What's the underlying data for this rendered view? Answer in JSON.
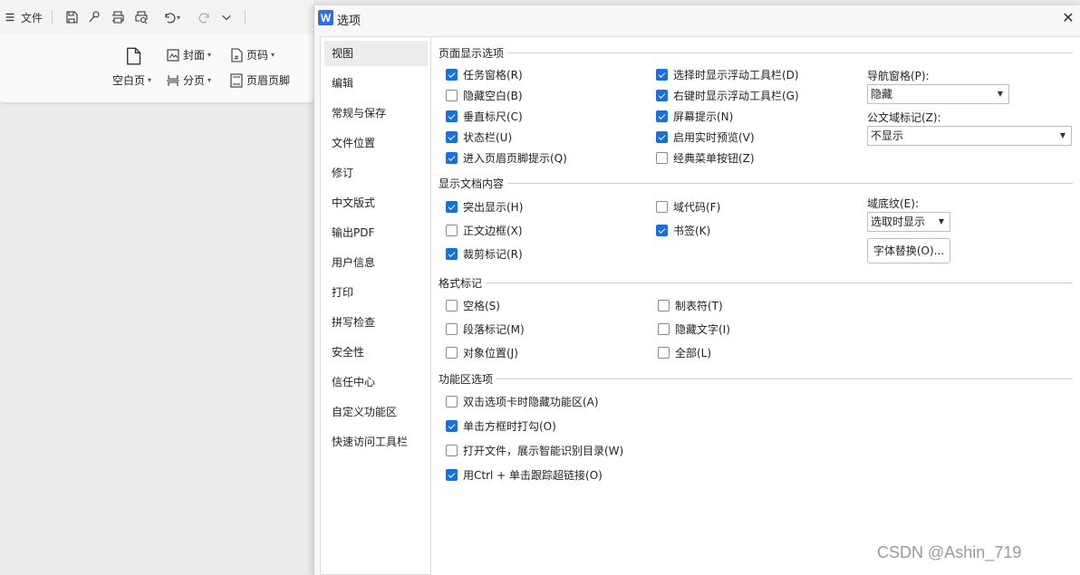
{
  "app": {
    "menu_label": "文件",
    "ribbon": {
      "cover": "封面",
      "page_number": "页码",
      "blank_page": "空白页",
      "page_break": "分页",
      "header_footer": "页眉页脚"
    }
  },
  "dialog": {
    "title": "选项",
    "logo": "W",
    "nav": [
      "视图",
      "编辑",
      "常规与保存",
      "文件位置",
      "修订",
      "中文版式",
      "输出PDF",
      "用户信息",
      "打印",
      "拼写检查",
      "安全性",
      "信任中心",
      "自定义功能区",
      "快速访问工具栏"
    ],
    "selected_nav": "视图",
    "page_display": {
      "heading": "页面显示选项",
      "col1": [
        {
          "label": "任务窗格(R)",
          "checked": true
        },
        {
          "label": "隐藏空白(B)",
          "checked": false
        },
        {
          "label": "垂直标尺(C)",
          "checked": true
        },
        {
          "label": "状态栏(U)",
          "checked": true
        },
        {
          "label": "进入页眉页脚提示(Q)",
          "checked": true
        }
      ],
      "col2": [
        {
          "label": "选择时显示浮动工具栏(D)",
          "checked": true
        },
        {
          "label": "右键时显示浮动工具栏(G)",
          "checked": true
        },
        {
          "label": "屏幕提示(N)",
          "checked": true
        },
        {
          "label": "启用实时预览(V)",
          "checked": true
        },
        {
          "label": "经典菜单按钮(Z)",
          "checked": false
        }
      ],
      "nav_pane_label": "导航窗格(P):",
      "nav_pane_value": "隐藏",
      "doc_field_label": "公文域标记(Z):",
      "doc_field_value": "不显示"
    },
    "doc_content": {
      "heading": "显示文档内容",
      "col1": [
        {
          "label": "突出显示(H)",
          "checked": true
        },
        {
          "label": "正文边框(X)",
          "checked": false
        },
        {
          "label": "裁剪标记(R)",
          "checked": true
        }
      ],
      "col2": [
        {
          "label": "域代码(F)",
          "checked": false
        },
        {
          "label": "书签(K)",
          "checked": true
        }
      ],
      "field_shading_label": "域底纹(E):",
      "field_shading_value": "选取时显示",
      "font_substitution_button": "字体替换(O)..."
    },
    "format_marks": {
      "heading": "格式标记",
      "col1": [
        {
          "label": "空格(S)",
          "checked": false
        },
        {
          "label": "段落标记(M)",
          "checked": false
        },
        {
          "label": "对象位置(J)",
          "checked": false
        }
      ],
      "col2": [
        {
          "label": "制表符(T)",
          "checked": false
        },
        {
          "label": "隐藏文字(I)",
          "checked": false
        },
        {
          "label": "全部(L)",
          "checked": false
        }
      ]
    },
    "ribbon_options": {
      "heading": "功能区选项",
      "items": [
        {
          "label": "双击选项卡时隐藏功能区(A)",
          "checked": false
        },
        {
          "label": "单击方框时打勾(O)",
          "checked": true
        },
        {
          "label": "打开文件，展示智能识别目录(W)",
          "checked": false
        },
        {
          "label": "用Ctrl + 单击跟踪超链接(O)",
          "checked": true
        }
      ]
    }
  },
  "watermark": "CSDN @Ashin_719",
  "colors": {
    "accent": "#1a6fd8",
    "logo": "#2d6fe6"
  }
}
